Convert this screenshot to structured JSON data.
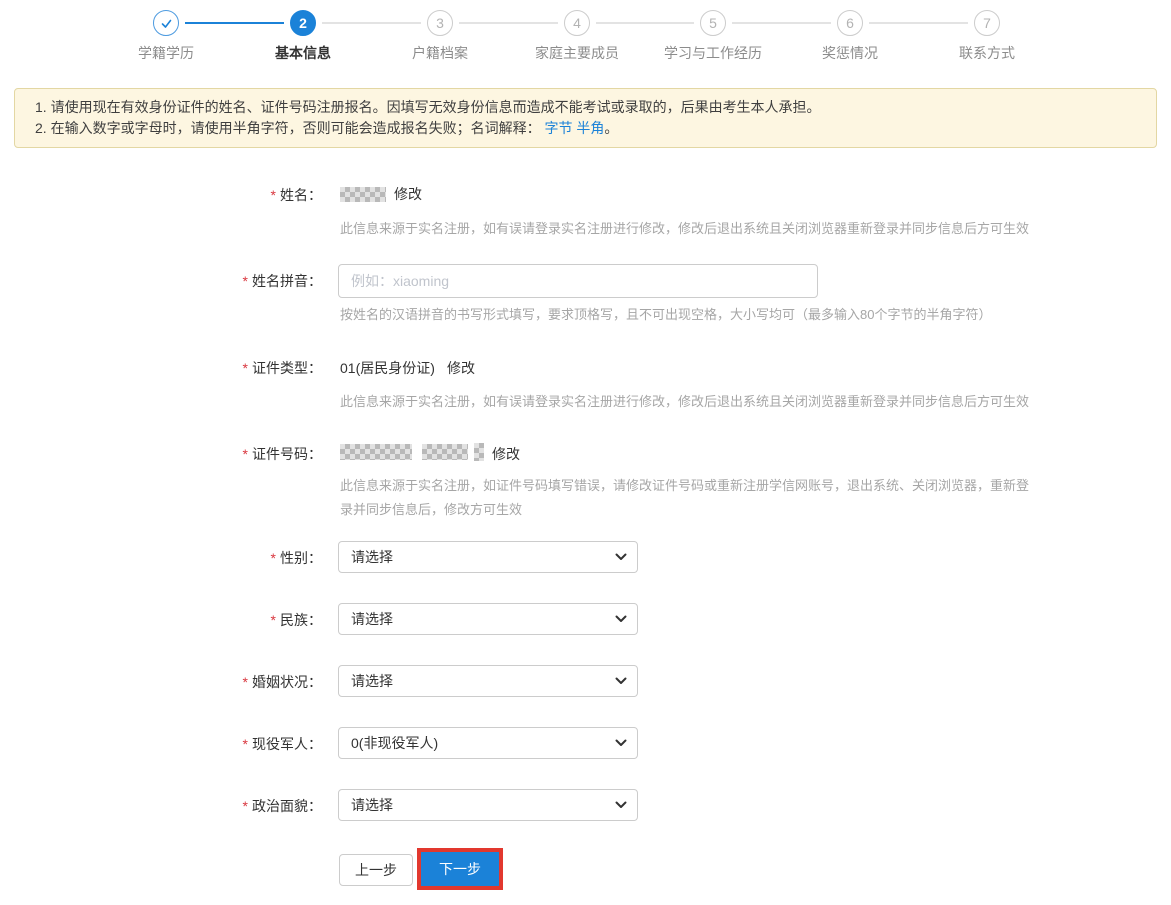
{
  "stepper": {
    "steps": [
      {
        "label": "学籍学历",
        "number": "1",
        "state": "done"
      },
      {
        "label": "基本信息",
        "number": "2",
        "state": "active"
      },
      {
        "label": "户籍档案",
        "number": "3",
        "state": "pending"
      },
      {
        "label": "家庭主要成员",
        "number": "4",
        "state": "pending"
      },
      {
        "label": "学习与工作经历",
        "number": "5",
        "state": "pending"
      },
      {
        "label": "奖惩情况",
        "number": "6",
        "state": "pending"
      },
      {
        "label": "联系方式",
        "number": "7",
        "state": "pending"
      }
    ]
  },
  "notice": {
    "line1": "1. 请使用现在有效身份证件的姓名、证件号码注册报名。因填写无效身份信息而造成不能考试或录取的，后果由考生本人承担。",
    "line2_prefix": "2. 在输入数字或字母时，请使用半角字符，否则可能会造成报名失败；名词解释： ",
    "link_byte": "字节",
    "link_halfwidth": "半角",
    "line2_suffix": "。"
  },
  "form": {
    "required_marker": "*",
    "modify_link": "修改",
    "name": {
      "label": "姓名：",
      "hint": "此信息来源于实名注册，如有误请登录实名注册进行修改，修改后退出系统且关闭浏览器重新登录并同步信息后方可生效"
    },
    "pinyin": {
      "label": "姓名拼音：",
      "placeholder": "例如：xiaoming",
      "value": "",
      "hint": "按姓名的汉语拼音的书写形式填写，要求顶格写，且不可出现空格，大小写均可（最多输入80个字节的半角字符）"
    },
    "id_type": {
      "label": "证件类型：",
      "value": "01(居民身份证)",
      "hint": "此信息来源于实名注册，如有误请登录实名注册进行修改，修改后退出系统且关闭浏览器重新登录并同步信息后方可生效"
    },
    "id_number": {
      "label": "证件号码：",
      "hint": "此信息来源于实名注册，如证件号码填写错误，请修改证件号码或重新注册学信网账号，退出系统、关闭浏览器，重新登录并同步信息后，修改方可生效"
    },
    "gender": {
      "label": "性别：",
      "value": "请选择"
    },
    "ethnicity": {
      "label": "民族：",
      "value": "请选择"
    },
    "marital_status": {
      "label": "婚姻状况：",
      "value": "请选择"
    },
    "military": {
      "label": "现役军人：",
      "value": "0(非现役军人)"
    },
    "political_status": {
      "label": "政治面貌：",
      "value": "请选择"
    }
  },
  "buttons": {
    "prev": "上一步",
    "next": "下一步"
  },
  "colors": {
    "accent_blue": "#1b82d8",
    "link_blue": "#1b82d8",
    "notice_bg": "#fdf6e1",
    "notice_border": "#e3d7a3",
    "required_red": "#d9363e",
    "highlight_red": "#e2382e"
  }
}
